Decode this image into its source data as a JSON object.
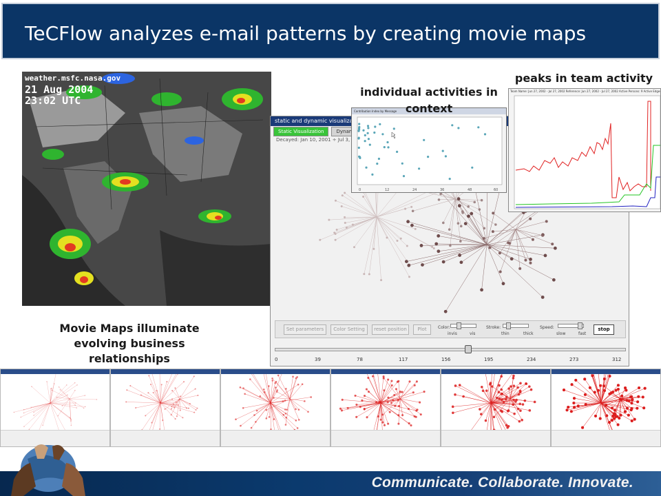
{
  "slide": {
    "title": "TeCFlow analyzes e-mail patterns by creating movie maps",
    "tagline": "Communicate. Collaborate. Innovate."
  },
  "weather_map": {
    "source": "weather.msfc.nasa.gov",
    "date": "21 Aug 2004",
    "time": "23:02 UTC"
  },
  "captions": {
    "movie_maps": "Movie Maps illuminate evolving business relationships",
    "individual": "individual activities in context",
    "peaks": "peaks in team activity"
  },
  "app_window": {
    "title": "static and dynamic visualization",
    "tabs": [
      "Static Visualization",
      "Dynamic Visualization"
    ],
    "date_range": "Decayed: Jan 10, 2001  ÷  Jul 3, 2001",
    "buttons": [
      "Set parameters",
      "Color Setting",
      "reset position",
      "Plot"
    ],
    "slider_labels": {
      "color": "Color:",
      "color_min": "invis",
      "color_max": "vis",
      "stroke": "Stroke:",
      "stroke_min": "thin",
      "stroke_max": "thick",
      "speed": "Speed:",
      "speed_min": "slow",
      "speed_max": "fast"
    },
    "stop_label": "stop",
    "timeline_ticks": [
      "0",
      "39",
      "78",
      "117",
      "156",
      "195",
      "234",
      "273",
      "312"
    ]
  },
  "indiv_window": {
    "title": "Contribution Index by Message",
    "x_ticks": [
      "0",
      "12",
      "24",
      "36",
      "48",
      "60"
    ]
  },
  "peaks_window": {
    "header": "Team Name: Jun 27, 2002 - Jul 27, 2002   Reference: Jun 27, 2002 - Jul 27, 2002   Active Persons: 9   Active Edges: 2"
  },
  "colors": {
    "title_bg": "#0b3566",
    "footer_bg": "#0b3a6e",
    "tab_active": "#39c439",
    "series_red": "#e02020",
    "series_green": "#22c422",
    "series_blue": "#2020c0",
    "scatter_dots": "#5aa6b8"
  }
}
